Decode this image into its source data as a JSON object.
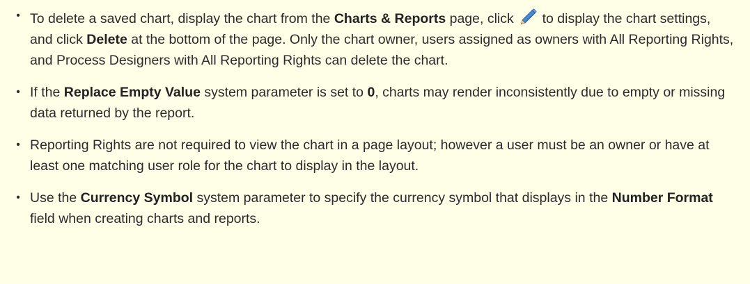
{
  "notes": [
    {
      "bullet": "•",
      "t1": "To delete a saved chart, display the chart from the ",
      "b1": "Charts & Reports",
      "t2": " page, click ",
      "icon": "pencil-icon",
      "t3": " to display the chart settings, and click ",
      "b2": "Delete",
      "t4": " at the bottom of the page. Only the chart owner, users assigned as owners with All Reporting Rights, and Process Designers with All Reporting Rights can delete the chart."
    },
    {
      "bullet": "•",
      "t1": "If the ",
      "b1": "Replace Empty Value",
      "t2": " system parameter is set to ",
      "b2": "0",
      "t3": ", charts may render inconsistently due to empty or missing data returned by the report."
    },
    {
      "bullet": "•",
      "t1": "Reporting Rights are not required to view the chart in a page layout; however a user must be an owner or have at least one matching user role for the chart to display in the layout."
    },
    {
      "bullet": "•",
      "t1": "Use the ",
      "b1": "Currency Symbol",
      "t2": " system parameter to specify the currency symbol that displays in the ",
      "b2": "Number Format",
      "t3": " field when creating charts and reports."
    }
  ],
  "colors": {
    "background": "#ffffe8",
    "text": "#2b2b2b",
    "icon_blue": "#2e78c8"
  }
}
